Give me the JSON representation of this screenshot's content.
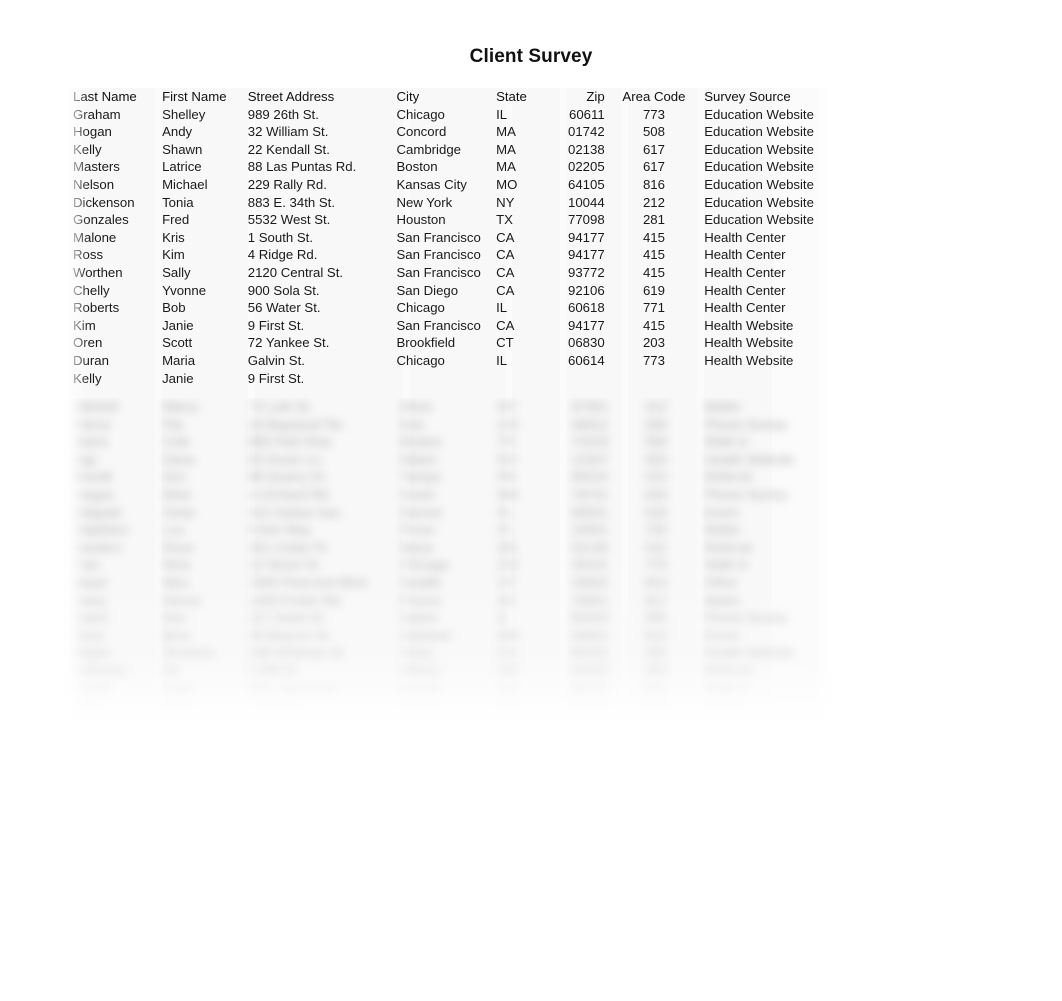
{
  "document": {
    "title": "Client Survey"
  },
  "table": {
    "name": "client-survey-table",
    "columns": [
      {
        "key": "last_name",
        "label": "Last Name",
        "align": "left"
      },
      {
        "key": "first_name",
        "label": "First Name",
        "align": "left"
      },
      {
        "key": "street_address",
        "label": "Street Address",
        "align": "left"
      },
      {
        "key": "city",
        "label": "City",
        "align": "left"
      },
      {
        "key": "state",
        "label": "State",
        "align": "left"
      },
      {
        "key": "zip",
        "label": "Zip",
        "align": "right"
      },
      {
        "key": "area_code",
        "label": "Area Code",
        "align": "center"
      },
      {
        "key": "survey_source",
        "label": "Survey Source",
        "align": "left"
      }
    ],
    "rows": [
      [
        "Graham",
        "Shelley",
        "989 26th St.",
        "Chicago",
        "IL",
        "60611",
        "773",
        "Education Website"
      ],
      [
        "Hogan",
        "Andy",
        "32 William St.",
        "Concord",
        "MA",
        "01742",
        "508",
        "Education Website"
      ],
      [
        "Kelly",
        "Shawn",
        "22 Kendall St.",
        "Cambridge",
        "MA",
        "02138",
        "617",
        "Education Website"
      ],
      [
        "Masters",
        "Latrice",
        "88 Las Puntas Rd.",
        "Boston",
        "MA",
        "02205",
        "617",
        "Education Website"
      ],
      [
        "Nelson",
        "Michael",
        "229 Rally Rd.",
        "Kansas City",
        "MO",
        "64105",
        "816",
        "Education Website"
      ],
      [
        "Dickenson",
        "Tonia",
        "883 E. 34th St.",
        "New York",
        "NY",
        "10044",
        "212",
        "Education Website"
      ],
      [
        "Gonzales",
        "Fred",
        "5532 West St.",
        "Houston",
        "TX",
        "77098",
        "281",
        "Education Website"
      ],
      [
        "Malone",
        "Kris",
        "1 South St.",
        "San Francisco",
        "CA",
        "94177",
        "415",
        "Health Center"
      ],
      [
        "Ross",
        "Kim",
        "4 Ridge Rd.",
        "San Francisco",
        "CA",
        "94177",
        "415",
        "Health Center"
      ],
      [
        "Worthen",
        "Sally",
        "2120 Central St.",
        "San Francisco",
        "CA",
        "93772",
        "415",
        "Health Center"
      ],
      [
        "Chelly",
        "Yvonne",
        "900 Sola St.",
        "San Diego",
        "CA",
        "92106",
        "619",
        "Health Center"
      ],
      [
        "Roberts",
        "Bob",
        "56 Water St.",
        "Chicago",
        "IL",
        "60618",
        "771",
        "Health Center"
      ],
      [
        "Kim",
        "Janie",
        "9 First St.",
        "San Francisco",
        "CA",
        "94177",
        "415",
        "Health Website"
      ],
      [
        "Oren",
        "Scott",
        "72 Yankee St.",
        "Brookfield",
        "CT",
        "06830",
        "203",
        "Health Website"
      ],
      [
        "Duran",
        "Maria",
        "Galvin St.",
        "Chicago",
        "IL",
        "60614",
        "773",
        "Health Website"
      ],
      [
        "Kelly",
        "Janie",
        "9 First St.",
        "",
        "",
        "",
        "",
        ""
      ]
    ],
    "obscured_note": "Remaining rows below are blurred and unreadable in the source image."
  }
}
